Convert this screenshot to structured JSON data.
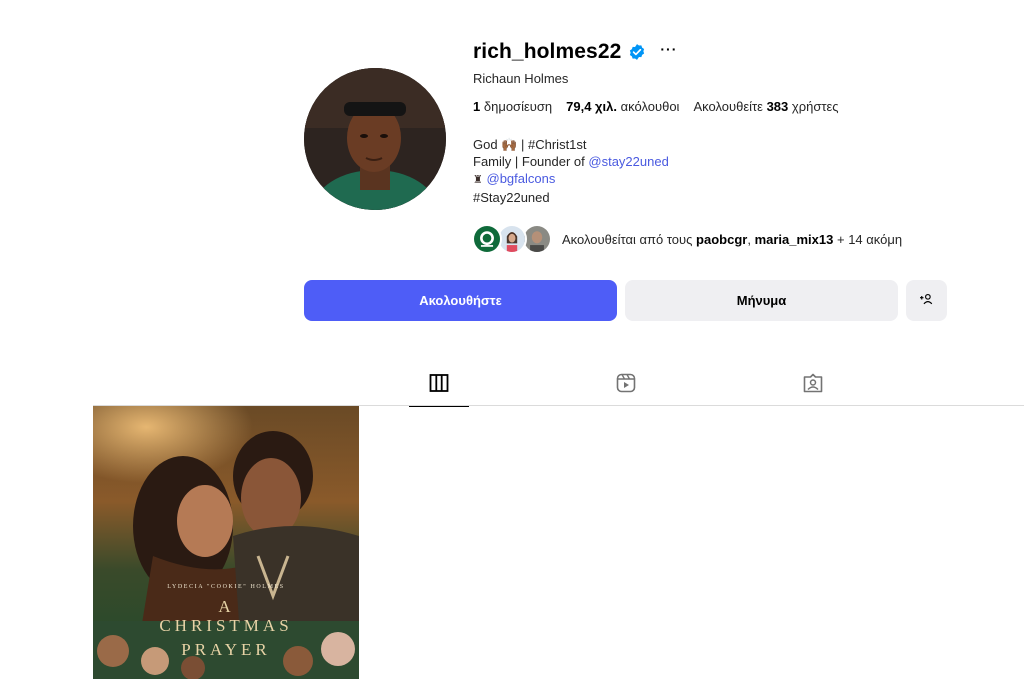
{
  "profile": {
    "username": "rich_holmes22",
    "full_name": "Richaun Holmes",
    "verified": true,
    "more_label": "···"
  },
  "stats": {
    "posts_value": "1",
    "posts_label": "δημοσίευση",
    "followers_value": "79,4 χιλ.",
    "followers_label": "ακόλουθοι",
    "following_prefix": "Ακολουθείτε",
    "following_value": "383",
    "following_suffix": "χρήστες"
  },
  "bio": {
    "line1_text": "God",
    "line1_emoji": "🙌🏾",
    "line1_rest": "| #Christ1st",
    "line2_text": "Family | Founder of",
    "line2_link": "@stay22uned",
    "line3_emoji": "♜",
    "line3_link": "@bgfalcons",
    "line4_text": "#Stay22uned"
  },
  "followed_by": {
    "prefix": "Ακολουθείται από τους",
    "user1": "paobcgr",
    "separator": ",",
    "user2": "maria_mix13",
    "suffix": "+ 14 ακόμη"
  },
  "buttons": {
    "follow": "Ακολουθήστε",
    "message": "Μήνυμα",
    "suggest_icon": "person-add-icon"
  },
  "tabs": [
    {
      "name": "posts",
      "icon": "grid-icon",
      "active": true
    },
    {
      "name": "reels",
      "icon": "reels-icon",
      "active": false
    },
    {
      "name": "tagged",
      "icon": "tagged-icon",
      "active": false
    }
  ],
  "post": {
    "credit": "LYDECIA \"COOKIE\" HOLMES",
    "title_a": "A",
    "title_line1": "CHRISTMAS",
    "title_line2": "PRAYER"
  },
  "colors": {
    "accent": "#4e5df7",
    "link": "#4a5ae0",
    "verified": "#0095f6",
    "secondary_button": "#efeff2"
  }
}
